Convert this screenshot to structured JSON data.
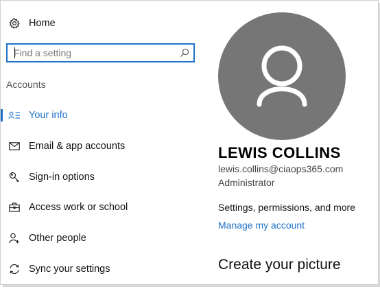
{
  "sidebar": {
    "home": {
      "label": "Home",
      "icon": "gear-icon"
    },
    "search": {
      "placeholder": "Find a setting",
      "value": "",
      "icon": "search-icon"
    },
    "section_title": "Accounts",
    "items": [
      {
        "label": "Your info",
        "icon": "person-card-icon",
        "active": true
      },
      {
        "label": "Email & app accounts",
        "icon": "envelope-icon",
        "active": false
      },
      {
        "label": "Sign-in options",
        "icon": "key-icon",
        "active": false
      },
      {
        "label": "Access work or school",
        "icon": "briefcase-icon",
        "active": false
      },
      {
        "label": "Other people",
        "icon": "person-add-icon",
        "active": false
      },
      {
        "label": "Sync your settings",
        "icon": "sync-icon",
        "active": false
      }
    ]
  },
  "main": {
    "avatar_icon": "user-silhouette-icon",
    "user_name": "LEWIS COLLINS",
    "email": "lewis.collins@ciaops365.com",
    "role": "Administrator",
    "settings_note": "Settings, permissions, and more",
    "manage_link": "Manage my account",
    "create_heading": "Create your picture"
  },
  "colors": {
    "accent": "#1e73c9",
    "avatar_bg": "#767676",
    "text": "#111111"
  }
}
